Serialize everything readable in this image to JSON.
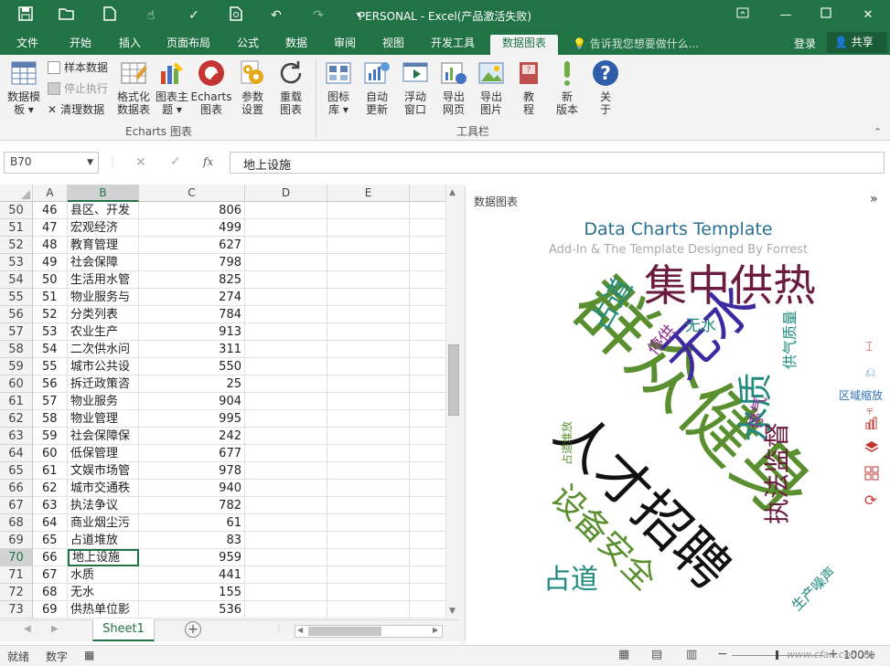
{
  "window": {
    "title": "PERSONAL - Excel(产品激活失败)",
    "brand_color": "#217346"
  },
  "tabs": [
    "文件",
    "开始",
    "插入",
    "页面布局",
    "公式",
    "数据",
    "审阅",
    "视图",
    "开发工具",
    "数据图表"
  ],
  "tellme": "告诉我您想要做什么...",
  "login": "登录",
  "share": "共享",
  "ribbon": {
    "template": "数据模\n板",
    "sample": "样本数据",
    "stop": "停止执行",
    "clear": "清理数据",
    "format": "格式化\n数据表",
    "theme": "图表主\n题",
    "echarts": "Echarts\n图表",
    "params": "参数\n设置",
    "reload": "重载\n图表",
    "group1": "Echarts 图表",
    "lib": "图标\n库",
    "auto": "自动\n更新",
    "float": "浮动\n窗口",
    "webpage": "导出\n网页",
    "image": "导出\n图片",
    "tutorial": "教\n程",
    "newver": "新\n版本",
    "about": "关\n于",
    "group2": "工具栏"
  },
  "namebox": "B70",
  "fx": "fx",
  "formula": "地上设施",
  "columns": [
    "A",
    "B",
    "C",
    "D",
    "E"
  ],
  "rows": [
    {
      "r": "50",
      "a": "46",
      "b": "县区、开发",
      "c": "806"
    },
    {
      "r": "51",
      "a": "47",
      "b": "宏观经济",
      "c": "499"
    },
    {
      "r": "52",
      "a": "48",
      "b": "教育管理",
      "c": "627"
    },
    {
      "r": "53",
      "a": "49",
      "b": "社会保障",
      "c": "798"
    },
    {
      "r": "54",
      "a": "50",
      "b": "生活用水管",
      "c": "825"
    },
    {
      "r": "55",
      "a": "51",
      "b": "物业服务与",
      "c": "274"
    },
    {
      "r": "56",
      "a": "52",
      "b": "分类列表",
      "c": "784"
    },
    {
      "r": "57",
      "a": "53",
      "b": "农业生产",
      "c": "913"
    },
    {
      "r": "58",
      "a": "54",
      "b": "二次供水问",
      "c": "311"
    },
    {
      "r": "59",
      "a": "55",
      "b": "城市公共设",
      "c": "550"
    },
    {
      "r": "60",
      "a": "56",
      "b": "拆迁政策咨",
      "c": "25"
    },
    {
      "r": "61",
      "a": "57",
      "b": "物业服务",
      "c": "904"
    },
    {
      "r": "62",
      "a": "58",
      "b": "物业管理",
      "c": "995"
    },
    {
      "r": "63",
      "a": "59",
      "b": "社会保障保",
      "c": "242"
    },
    {
      "r": "64",
      "a": "60",
      "b": "低保管理",
      "c": "677"
    },
    {
      "r": "65",
      "a": "61",
      "b": "文娱市场管",
      "c": "978"
    },
    {
      "r": "66",
      "a": "62",
      "b": "城市交通秩",
      "c": "940"
    },
    {
      "r": "67",
      "a": "63",
      "b": "执法争议",
      "c": "782"
    },
    {
      "r": "68",
      "a": "64",
      "b": "商业烟尘污",
      "c": "61"
    },
    {
      "r": "69",
      "a": "65",
      "b": "占道堆放",
      "c": "83"
    },
    {
      "r": "70",
      "a": "66",
      "b": "地上设施",
      "c": "959"
    },
    {
      "r": "71",
      "a": "67",
      "b": "水质",
      "c": "441"
    },
    {
      "r": "72",
      "a": "68",
      "b": "无水",
      "c": "155"
    },
    {
      "r": "73",
      "a": "69",
      "b": "供热单位影",
      "c": "536"
    }
  ],
  "sheet": "Sheet1",
  "pane": {
    "title": "数据图表",
    "chart_title": "Data Charts Template",
    "chart_subtitle": "Add-In & The Template Designed By Forrest",
    "zoom_label": "区域缩放"
  },
  "words": [
    {
      "t": "集中供热",
      "c": "#6b1b3f"
    },
    {
      "t": "群众健身",
      "c": "#5a8f2f"
    },
    {
      "t": "人才招聘",
      "c": "#111111"
    },
    {
      "t": "无水",
      "c": "#3d2aa0"
    },
    {
      "t": "水质",
      "c": "#208a7e"
    },
    {
      "t": "执法监督",
      "c": "#6b1b3f"
    },
    {
      "t": "设备安全",
      "c": "#5a8f2f"
    },
    {
      "t": "占道",
      "c": "#208a7e"
    },
    {
      "t": "占道",
      "c": "#208a7e"
    },
    {
      "t": "停气",
      "c": "#8e2b8e"
    },
    {
      "t": "停供",
      "c": "#8e2b8e"
    },
    {
      "t": "无水",
      "c": "#208a7e"
    },
    {
      "t": "供气质量",
      "c": "#208a7e"
    },
    {
      "t": "生产噪声",
      "c": "#208a7e"
    },
    {
      "t": "占道堆放",
      "c": "#5a8f2f"
    }
  ],
  "status": {
    "ready": "就绪",
    "mode": "数字",
    "zoom": "100%",
    "watermark": "www.cfan.com.cn"
  }
}
